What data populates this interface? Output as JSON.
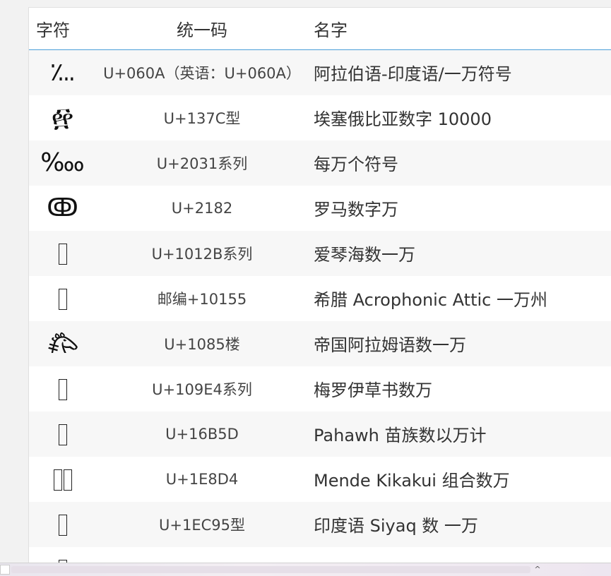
{
  "header": {
    "char_label": "字符",
    "code_label": "统一码",
    "name_label": "名字"
  },
  "rows": [
    {
      "glyph": "؊",
      "code": "U+060A（英语：U+060A）",
      "name": "阿拉伯语-印度语/一万符号"
    },
    {
      "glyph": "፼",
      "code": "U+137C型",
      "name": "埃塞俄比亚数字 10000"
    },
    {
      "glyph": "‱",
      "code": "U+2031系列",
      "name": "每万个符号"
    },
    {
      "glyph": "ↂ",
      "code": "U+2182",
      "name": "罗马数字万"
    },
    {
      "glyph": "",
      "code": "U+1012B系列",
      "name": "爱琴海数一万"
    },
    {
      "glyph": "",
      "code": "邮编+10155",
      "name": "希腊 Acrophonic Attic 一万州"
    },
    {
      "glyph": "𐂅",
      "code": "U+1085楼",
      "name": "帝国阿拉姆语数一万"
    },
    {
      "glyph": "",
      "code": "U+109E4系列",
      "name": "梅罗伊草书数万"
    },
    {
      "glyph": "",
      "code": "U+16B5D",
      "name": "Pahawh 苗族数以万计"
    },
    {
      "glyph": "",
      "code": "U+1E8D4",
      "name": "Mende Kikakui 组合数万"
    },
    {
      "glyph": "",
      "code": "U+1EC95型",
      "name": "印度语 Siyaq 数 一万"
    }
  ],
  "scroll": {
    "up_arrow": "^"
  }
}
